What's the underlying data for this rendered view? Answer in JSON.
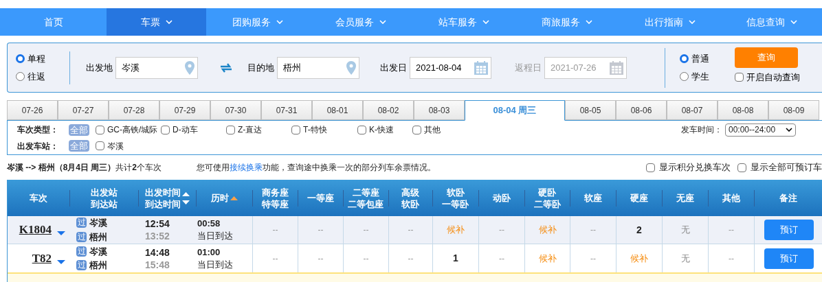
{
  "nav": [
    {
      "label": "首页",
      "dropdown": false,
      "selected": false
    },
    {
      "label": "车票",
      "dropdown": true,
      "selected": true
    },
    {
      "label": "团购服务",
      "dropdown": true,
      "selected": false
    },
    {
      "label": "会员服务",
      "dropdown": true,
      "selected": false
    },
    {
      "label": "站车服务",
      "dropdown": true,
      "selected": false
    },
    {
      "label": "商旅服务",
      "dropdown": true,
      "selected": false
    },
    {
      "label": "出行指南",
      "dropdown": true,
      "selected": false
    },
    {
      "label": "信息查询",
      "dropdown": true,
      "selected": false
    }
  ],
  "search": {
    "trip_types": [
      {
        "label": "单程",
        "selected": true
      },
      {
        "label": "往返",
        "selected": false
      }
    ],
    "from": {
      "label": "出发地",
      "value": "岑溪"
    },
    "to": {
      "label": "目的地",
      "value": "梧州"
    },
    "depart": {
      "label": "出发日",
      "value": "2021-08-04",
      "disabled": false
    },
    "return": {
      "label": "返程日",
      "value": "2021-07-26",
      "disabled": true
    },
    "passenger_types": [
      {
        "label": "普通",
        "selected": true
      },
      {
        "label": "学生",
        "selected": false
      }
    ],
    "query_button": "查询",
    "auto_query": {
      "label": "开启自动查询",
      "checked": false
    }
  },
  "date_tabs": [
    {
      "label": "07-26",
      "selected": false
    },
    {
      "label": "07-27",
      "selected": false
    },
    {
      "label": "07-28",
      "selected": false
    },
    {
      "label": "07-29",
      "selected": false
    },
    {
      "label": "07-30",
      "selected": false
    },
    {
      "label": "07-31",
      "selected": false
    },
    {
      "label": "08-01",
      "selected": false
    },
    {
      "label": "08-02",
      "selected": false
    },
    {
      "label": "08-03",
      "selected": false
    },
    {
      "label": "08-04 周三",
      "selected": true
    },
    {
      "label": "08-05",
      "selected": false
    },
    {
      "label": "08-06",
      "selected": false
    },
    {
      "label": "08-07",
      "selected": false
    },
    {
      "label": "08-08",
      "selected": false
    },
    {
      "label": "08-09",
      "selected": false
    }
  ],
  "filters": {
    "train_types": {
      "label": "车次类型：",
      "all": {
        "label": "全部",
        "selected": true
      },
      "options": [
        {
          "label": "GC-高铁/城际",
          "checked": false
        },
        {
          "label": "D-动车",
          "checked": false
        },
        {
          "label": "Z-直达",
          "checked": false
        },
        {
          "label": "T-特快",
          "checked": false
        },
        {
          "label": "K-快速",
          "checked": false
        },
        {
          "label": "其他",
          "checked": false
        }
      ]
    },
    "stations": {
      "label": "出发车站：",
      "all": {
        "label": "全部",
        "selected": true
      },
      "options": [
        {
          "label": "岑溪",
          "checked": false
        }
      ]
    },
    "depart_time": {
      "label": "发车时间：",
      "value": "00:00--24:00"
    }
  },
  "summary": {
    "text": "**岑溪 --> 梧州（8月4日  周三）**共计**2**个车次",
    "hint_before": "您可使用",
    "hint_link": "接续换乘",
    "hint_after": "功能，查询途中换乘一次的部分列车余票情况。",
    "options": [
      {
        "label": "显示积分兑换车次",
        "checked": false
      },
      {
        "label": "显示全部可预订车",
        "checked": false
      }
    ]
  },
  "table": {
    "columns": [
      {
        "lines": [
          "车次"
        ],
        "kind": "plain"
      },
      {
        "lines": [
          "出发站",
          "到达站"
        ],
        "kind": "plain"
      },
      {
        "lines": [
          "出发时间",
          "到达时间"
        ],
        "kind": "sortable"
      },
      {
        "lines": [
          "历时"
        ],
        "kind": "sorted"
      },
      {
        "lines": [
          "商务座",
          "特等座"
        ],
        "kind": "plain"
      },
      {
        "lines": [
          "一等座"
        ],
        "kind": "plain"
      },
      {
        "lines": [
          "二等座",
          "二等包座"
        ],
        "kind": "plain"
      },
      {
        "lines": [
          "高级",
          "软卧"
        ],
        "kind": "plain"
      },
      {
        "lines": [
          "软卧",
          "一等卧"
        ],
        "kind": "plain"
      },
      {
        "lines": [
          "动卧"
        ],
        "kind": "plain"
      },
      {
        "lines": [
          "硬卧",
          "二等卧"
        ],
        "kind": "plain"
      },
      {
        "lines": [
          "软座"
        ],
        "kind": "plain"
      },
      {
        "lines": [
          "硬座"
        ],
        "kind": "plain"
      },
      {
        "lines": [
          "无座"
        ],
        "kind": "plain"
      },
      {
        "lines": [
          "其他"
        ],
        "kind": "plain"
      },
      {
        "lines": [
          "备注"
        ],
        "kind": "plain"
      }
    ],
    "rows": [
      {
        "train": "K1804",
        "from_badge": "过",
        "from": "岑溪",
        "to_badge": "过",
        "to": "梧州",
        "depart": "12:54",
        "arrive": "13:52",
        "duration": "00:58",
        "arrival_day": "当日到达",
        "seats": [
          {
            "text": "--",
            "kind": "none"
          },
          {
            "text": "--",
            "kind": "none"
          },
          {
            "text": "--",
            "kind": "none"
          },
          {
            "text": "--",
            "kind": "none"
          },
          {
            "text": "候补",
            "kind": "waitlist"
          },
          {
            "text": "--",
            "kind": "none"
          },
          {
            "text": "候补",
            "kind": "waitlist"
          },
          {
            "text": "--",
            "kind": "none"
          },
          {
            "text": "2",
            "kind": "count"
          },
          {
            "text": "无",
            "kind": "soldout"
          },
          {
            "text": "--",
            "kind": "none"
          }
        ],
        "button": "预订"
      },
      {
        "train": "T82",
        "from_badge": "过",
        "from": "岑溪",
        "to_badge": "过",
        "to": "梧州",
        "depart": "14:48",
        "arrive": "15:48",
        "duration": "01:00",
        "arrival_day": "当日到达",
        "seats": [
          {
            "text": "--",
            "kind": "none"
          },
          {
            "text": "--",
            "kind": "none"
          },
          {
            "text": "--",
            "kind": "none"
          },
          {
            "text": "--",
            "kind": "none"
          },
          {
            "text": "1",
            "kind": "count"
          },
          {
            "text": "--",
            "kind": "none"
          },
          {
            "text": "候补",
            "kind": "waitlist"
          },
          {
            "text": "--",
            "kind": "none"
          },
          {
            "text": "候补",
            "kind": "waitlist"
          },
          {
            "text": "无",
            "kind": "soldout"
          },
          {
            "text": "--",
            "kind": "none"
          }
        ],
        "button": "预订"
      }
    ]
  }
}
